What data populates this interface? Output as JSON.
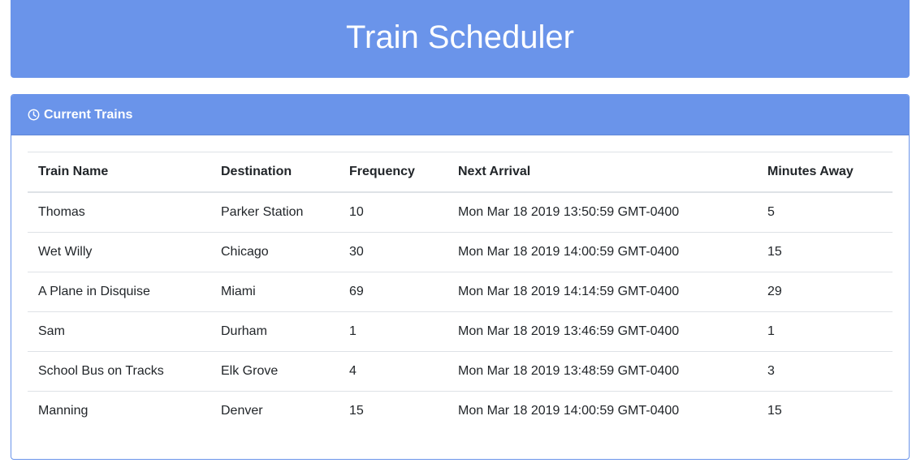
{
  "header": {
    "title": "Train Scheduler"
  },
  "panel": {
    "title": "Current Trains",
    "icon": "clock-icon",
    "accent_color": "#6a94ea"
  },
  "table": {
    "columns": [
      "Train Name",
      "Destination",
      "Frequency",
      "Next Arrival",
      "Minutes Away"
    ],
    "rows": [
      [
        "Thomas",
        "Parker Station",
        "10",
        "Mon Mar 18 2019 13:50:59 GMT-0400",
        "5"
      ],
      [
        "Wet Willy",
        "Chicago",
        "30",
        "Mon Mar 18 2019 14:00:59 GMT-0400",
        "15"
      ],
      [
        "A Plane in Disquise",
        "Miami",
        "69",
        "Mon Mar 18 2019 14:14:59 GMT-0400",
        "29"
      ],
      [
        "Sam",
        "Durham",
        "1",
        "Mon Mar 18 2019 13:46:59 GMT-0400",
        "1"
      ],
      [
        "School Bus on Tracks",
        "Elk Grove",
        "4",
        "Mon Mar 18 2019 13:48:59 GMT-0400",
        "3"
      ],
      [
        "Manning",
        "Denver",
        "15",
        "Mon Mar 18 2019 14:00:59 GMT-0400",
        "15"
      ]
    ]
  }
}
